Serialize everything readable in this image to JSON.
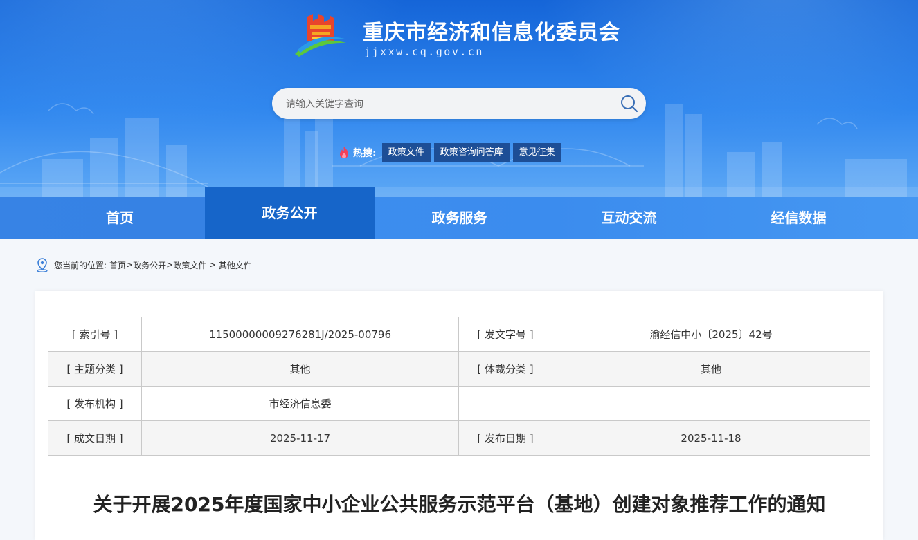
{
  "site": {
    "title": "重庆市经济和信息化委员会",
    "domain": "jjxxw.cq.gov.cn"
  },
  "search": {
    "placeholder": "请输入关键字查询"
  },
  "hot": {
    "label": "热搜:",
    "tags": [
      "政策文件",
      "政策咨询问答库",
      "意见征集"
    ]
  },
  "nav": {
    "items": [
      "首页",
      "政务公开",
      "政务服务",
      "互动交流",
      "经信数据"
    ],
    "active": "政务公开"
  },
  "breadcrumb": {
    "prefix": "您当前的位置:",
    "items": [
      "首页",
      "政务公开",
      "政策文件",
      "其他文件"
    ],
    "separators": [
      ">",
      ">",
      " > "
    ]
  },
  "meta": {
    "rows": [
      [
        "[ 索引号 ]",
        "11500000009276281J/2025-00796",
        "[ 发文字号 ]",
        "渝经信中小〔2025〕42号"
      ],
      [
        "[ 主题分类 ]",
        "其他",
        "[ 体裁分类 ]",
        "其他"
      ],
      [
        "[ 发布机构 ]",
        "市经济信息委",
        "",
        ""
      ],
      [
        "[ 成文日期 ]",
        "2025-11-17",
        "[ 发布日期 ]",
        "2025-11-18"
      ]
    ]
  },
  "document": {
    "title": "关于开展2025年度国家中小企业公共服务示范平台（基地）创建对象推荐工作的通知"
  }
}
